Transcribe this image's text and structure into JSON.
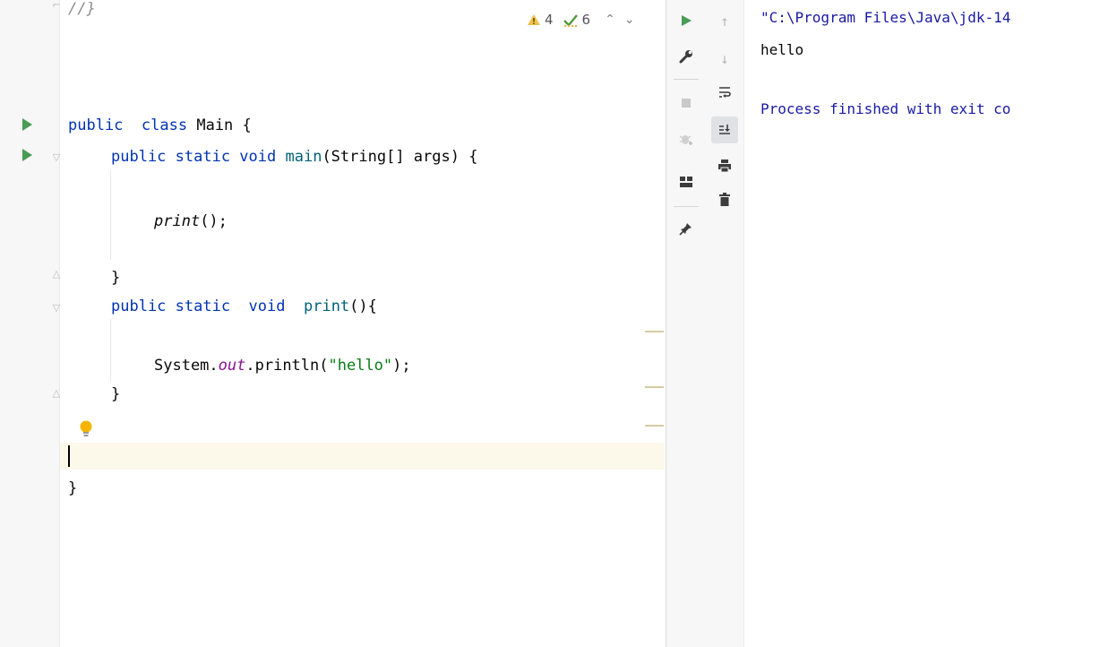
{
  "editor": {
    "lines": {
      "comment": "//}",
      "class_kw": "public",
      "class_kw2": "class",
      "class_name": "Main {",
      "main_kw": "public static void",
      "main_fn": "main",
      "main_params": "(String[] args) {",
      "print_call": "print",
      "print_call_rest": "();",
      "close_main": "}",
      "print_kw1": "public static",
      "print_kw2": "void",
      "print_fn": "print",
      "print_rest": "(){",
      "sys": "System.",
      "sys_out": "out",
      "sys_println": ".println(",
      "sys_str": "\"hello\"",
      "sys_end": ");",
      "close_print": "}",
      "close_class": "}"
    },
    "inspections": {
      "warnings": "4",
      "weak_warnings": "6"
    }
  },
  "console": {
    "lines": [
      "\"C:\\Program Files\\Java\\jdk-14",
      "hello",
      "",
      "Process finished with exit co"
    ]
  },
  "colors": {
    "keyword": "#0033b3",
    "function": "#00627a",
    "string": "#067d17",
    "field": "#871094",
    "console_text": "#1a1aa6",
    "run_green": "#499c54"
  },
  "icons": {
    "run": "run-icon",
    "wrench": "wrench-icon",
    "stop": "stop-icon",
    "debug": "bug-icon",
    "layout": "layout-icon",
    "pin": "pin-icon",
    "up": "arrow-up-icon",
    "down": "arrow-down-icon",
    "soft_wrap": "soft-wrap-icon",
    "scroll_end": "scroll-to-end-icon",
    "print": "printer-icon",
    "trash": "trash-icon"
  }
}
